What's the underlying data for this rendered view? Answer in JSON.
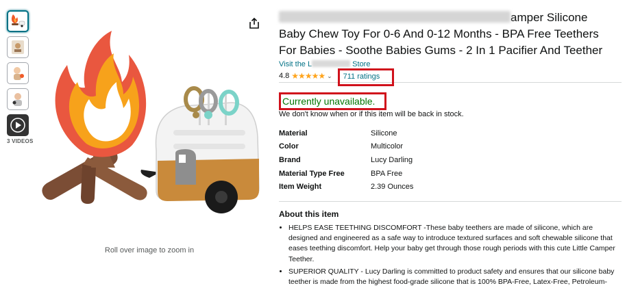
{
  "product": {
    "title_line1_visible": "amper Silicone",
    "title_line2": "Baby Chew Toy For 0-6 And 0-12 Months - BPA Free Teethers",
    "title_line3": "For Babies - Soothe Babies Gums - 2 In 1 Pacifier And Teether",
    "store_prefix": "Visit the L",
    "store_suffix": "Store",
    "rating_value": "4.8",
    "stars": "★★★★★",
    "ratings_count": "711 ratings",
    "availability": "Currently unavailable.",
    "availability_note": "We don't know when or if this item will be back in stock."
  },
  "specs": [
    {
      "key": "Material",
      "value": "Silicone"
    },
    {
      "key": "Color",
      "value": "Multicolor"
    },
    {
      "key": "Brand",
      "value": "Lucy Darling"
    },
    {
      "key": "Material Type Free",
      "value": "BPA Free"
    },
    {
      "key": "Item Weight",
      "value": "2.39 Ounces"
    }
  ],
  "about": {
    "heading": "About this item",
    "bullets": [
      "HELPS EASE TEETHING DISCOMFORT -These baby teethers are made of silicone, which are designed and engineered as a safe way to introduce textured surfaces and soft chewable silicone that eases teething discomfort. Help your baby get through those rough periods with this cute Little Camper Teether.",
      "SUPERIOR QUALITY - Lucy Darling is committed to product safety and ensures that our silicone baby teether is made from the highest food-grade silicone that is 100% BPA-Free, Latex-Free, Petroleum-Free, Lead-Free, and Phthalates-Free, thus zero worry about your toddler's health."
    ]
  },
  "gallery": {
    "video_label": "3 VIDEOS",
    "zoom_hint": "Roll over image to zoom in"
  },
  "icons": {
    "share": "share-icon",
    "chevron": "chevron-down-icon",
    "play": "play-icon"
  },
  "colors": {
    "link": "#007185",
    "available_green": "#007600",
    "highlight_red": "#d0111b",
    "star": "#ffa41c"
  }
}
